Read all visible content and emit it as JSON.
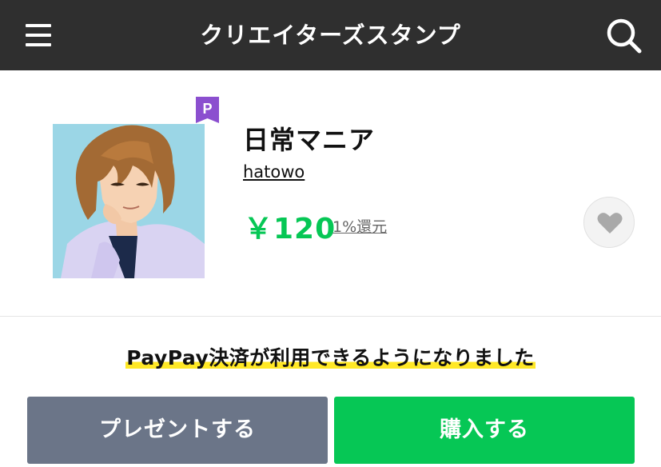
{
  "header": {
    "title": "クリエイターズスタンプ",
    "menu_icon": "hamburger-menu-icon",
    "search_icon": "search-icon"
  },
  "sticker": {
    "title": "日常マニア",
    "author": "hatowo",
    "price": "￥120",
    "cashback": "1%還元",
    "badge_label": "P",
    "thumbnail_icon": "sticker-thumbnail",
    "favorite_icon": "heart-icon"
  },
  "notice": {
    "text": "PayPay決済が利用できるようになりました"
  },
  "actions": {
    "gift_label": "プレゼントする",
    "buy_label": "購入する"
  },
  "colors": {
    "header_bg": "#2f2f2f",
    "price_green": "#06c755",
    "gift_button": "#6b7588",
    "buy_button": "#06c755",
    "badge_purple": "#8b4fcf",
    "highlight_yellow": "#ffe826"
  }
}
